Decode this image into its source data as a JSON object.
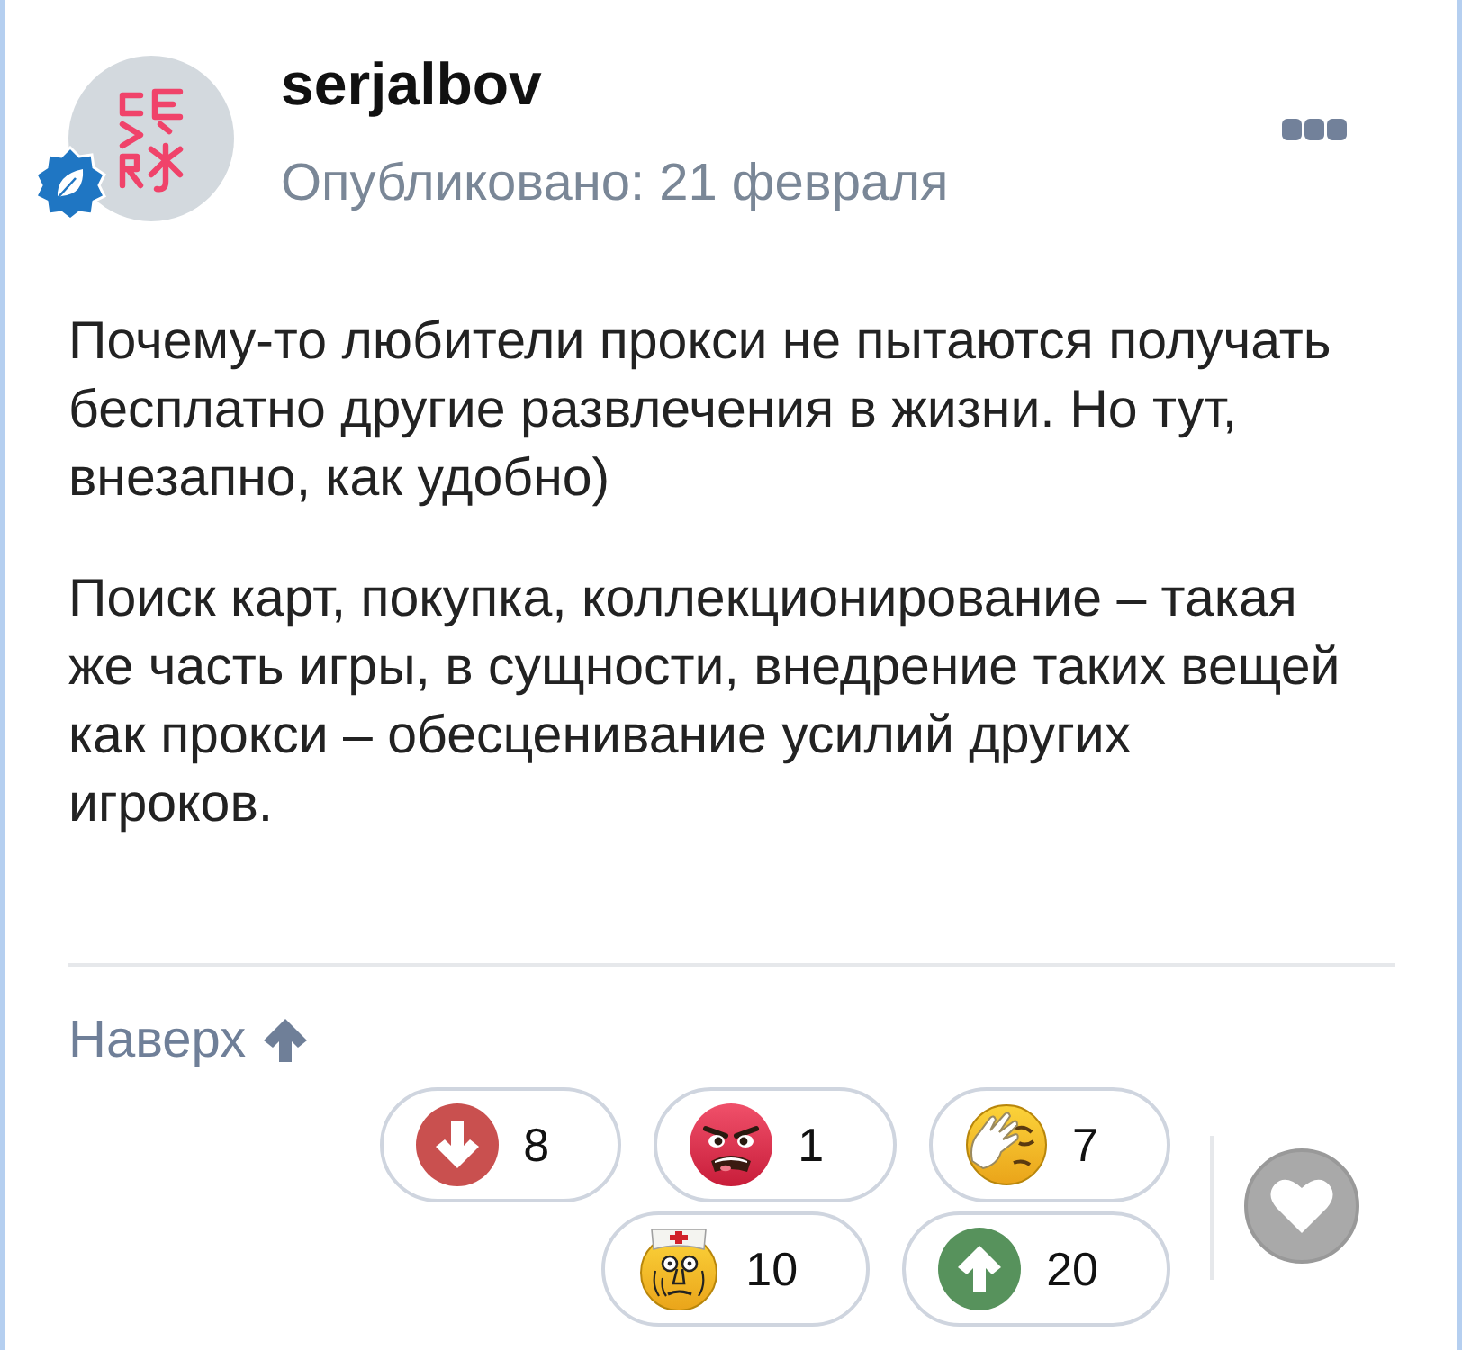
{
  "author": {
    "name": "serjalbov",
    "published": "Опубликовано: 21 февраля",
    "verified": true
  },
  "post": {
    "paragraphs": [
      "Почему-то любители прокси не пытаются получать бесплатно другие развлечения в жизни. Но тут, внезапно, как удобно)",
      "Поиск карт, покупка, коллекционирование – такая же часть игры, в сущности, внедрение таких вещей как прокси – обесценивание усилий других игроков."
    ]
  },
  "footer": {
    "to_top": "Наверх"
  },
  "reactions": [
    {
      "kind": "downvote",
      "count": "8"
    },
    {
      "kind": "angry",
      "count": "1"
    },
    {
      "kind": "facepalm",
      "count": "7"
    },
    {
      "kind": "doctor",
      "count": "10"
    },
    {
      "kind": "upvote",
      "count": "20"
    }
  ],
  "like": {
    "liked": false
  }
}
